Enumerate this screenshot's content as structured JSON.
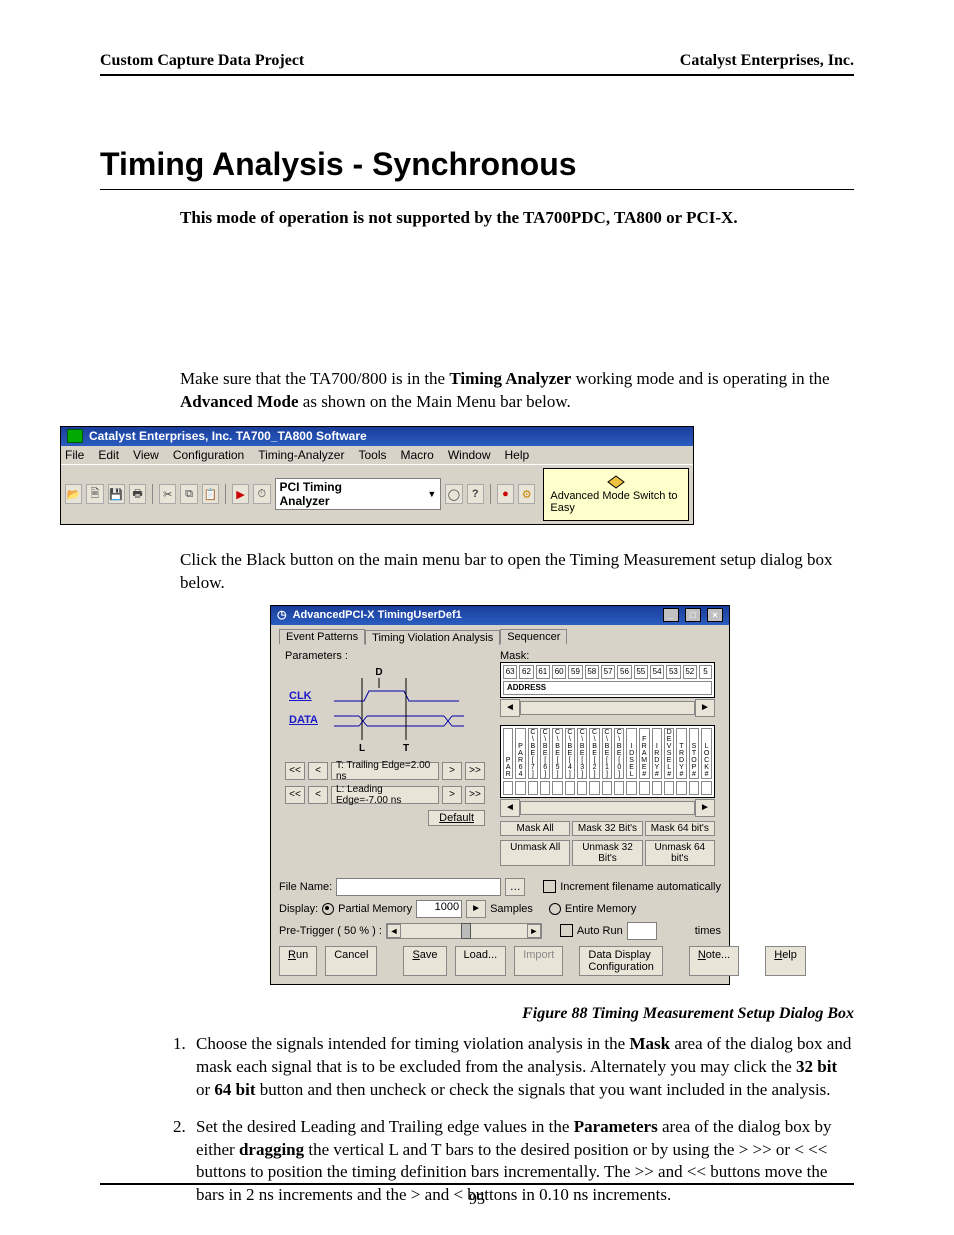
{
  "header": {
    "left": "Custom Capture Data Project",
    "right": "Catalyst Enterprises, Inc."
  },
  "title": "Timing Analysis - Synchronous",
  "note": "This mode of operation is not supported by the TA700PDC, TA800 or PCI-X.",
  "para1_a": "Make sure that the TA700/800 is in the ",
  "para1_b": "Timing Analyzer",
  "para1_c": " working mode and is operating in the ",
  "para1_d": "Advanced Mode",
  "para1_e": " as shown on the Main Menu bar below.",
  "shot1": {
    "title": "Catalyst Enterprises, Inc. TA700_TA800 Software",
    "menus": [
      "File",
      "Edit",
      "View",
      "Configuration",
      "Timing-Analyzer",
      "Tools",
      "Macro",
      "Window",
      "Help"
    ],
    "combo": "PCI Timing Analyzer",
    "status": "Advanced Mode Switch to Easy"
  },
  "para2": "Click the Black button on the main menu bar to open the Timing Measurement setup dialog box below.",
  "shot2": {
    "title": "AdvancedPCI-X TimingUserDef1",
    "tabs": [
      "Event Patterns",
      "Timing Violation Analysis",
      "Sequencer"
    ],
    "params_label": "Parameters :",
    "mask_label": "Mask:",
    "clk": "CLK",
    "data": "DATA",
    "L": "L",
    "T": "T",
    "D": "D",
    "trailing": "T: Trailing Edge=2.00 ns",
    "leading": "L: Leading Edge=-7.00 ns",
    "default": "Default",
    "mask_nums": [
      "63",
      "62",
      "61",
      "60",
      "59",
      "58",
      "57",
      "56",
      "55",
      "54",
      "53",
      "52",
      "5"
    ],
    "address": "ADDRESS",
    "mask_sig": [
      "PAR",
      "PAR64",
      "C\\BE[7]",
      "C\\BE[6]",
      "C\\BE[5]",
      "C\\BE[4]",
      "C\\BE[3]",
      "C\\BE[2]",
      "C\\BE[1]",
      "C\\BE[0]",
      "IDSEL",
      "FRAME#",
      "IRDY#",
      "DEVSEL#",
      "TRDY#",
      "STOP#",
      "LOCK#"
    ],
    "maskbtns_r1": [
      "Mask All",
      "Mask 32 Bit's",
      "Mask 64 bit's"
    ],
    "maskbtns_r2": [
      "Unmask All",
      "Unmask 32 Bit's",
      "Unmask 64 bit's"
    ],
    "file_label": "File Name:",
    "increment": "Increment filename automatically",
    "display": "Display:",
    "partial": "Partial Memory",
    "partial_val": "1000",
    "samples": "Samples",
    "entire": "Entire Memory",
    "pretrig": "Pre-Trigger ( 50 % ) :",
    "autorun": "Auto Run",
    "times": "times",
    "run": "Run",
    "cancel": "Cancel",
    "save": "Save",
    "load": "Load...",
    "import": "Import",
    "ddc": "Data Display Configuration",
    "noteb": "Note...",
    "help": "Help"
  },
  "caption": "Figure  88  Timing Measurement Setup Dialog Box",
  "li1_a": "Choose the signals intended for timing violation analysis in the ",
  "li1_b": "Mask",
  "li1_c": " area of the dialog box and mask each signal that is to be excluded from the analysis. Alternately you may click the ",
  "li1_d": "32 bit",
  "li1_e": " or ",
  "li1_f": "64 bit",
  "li1_g": " button and then uncheck or check the signals that you want included in the analysis.",
  "li2_a": "Set the desired Leading and Trailing edge values in the ",
  "li2_b": "Parameters",
  "li2_c": " area of the dialog box by either ",
  "li2_d": "dragging",
  "li2_e": " the vertical L and T bars to the desired position or by using the > >> or < << buttons to position the timing definition bars incrementally. The >> and << buttons move the bars in 2 ns increments and the > and < buttons in 0.10 ns increments.",
  "pagenum": "95"
}
